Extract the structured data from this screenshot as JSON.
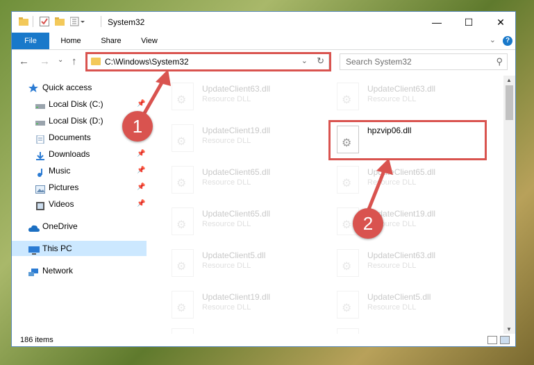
{
  "window": {
    "title": "System32",
    "min": "—",
    "max": "☐",
    "close": "✕"
  },
  "ribbon": {
    "tabs": [
      "File",
      "Home",
      "Share",
      "View"
    ],
    "expand": "⌄",
    "help": "?"
  },
  "nav": {
    "back": "←",
    "forward": "→",
    "recent": "⌄",
    "up": "↑"
  },
  "address": {
    "path": "C:\\Windows\\System32",
    "dropdown": "⌄",
    "refresh": "↻"
  },
  "search": {
    "placeholder": "Search System32",
    "icon": "⚲"
  },
  "sidebar": {
    "items": [
      {
        "label": "Quick access",
        "icon": "star-icon",
        "pinned": false
      },
      {
        "label": "Local Disk (C:)",
        "icon": "drive-icon",
        "pinned": true
      },
      {
        "label": "Local Disk (D:)",
        "icon": "drive-icon",
        "pinned": true
      },
      {
        "label": "Documents",
        "icon": "documents-icon",
        "pinned": true
      },
      {
        "label": "Downloads",
        "icon": "downloads-icon",
        "pinned": true
      },
      {
        "label": "Music",
        "icon": "music-icon",
        "pinned": true
      },
      {
        "label": "Pictures",
        "icon": "pictures-icon",
        "pinned": true
      },
      {
        "label": "Videos",
        "icon": "videos-icon",
        "pinned": true
      },
      {
        "label": "OneDrive",
        "icon": "onedrive-icon",
        "pinned": false
      },
      {
        "label": "This PC",
        "icon": "this-pc-icon",
        "pinned": false,
        "selected": true
      },
      {
        "label": "Network",
        "icon": "network-icon",
        "pinned": false
      }
    ],
    "pin_glyph": "📌"
  },
  "files": [
    {
      "name": "UpdateClient63.dll",
      "type": "Resource DLL"
    },
    {
      "name": "UpdateClient63.dll",
      "type": "Resource DLL"
    },
    {
      "name": "UpdateClient19.dll",
      "type": "Resource DLL"
    },
    {
      "name": "hpzvip06.dll",
      "type": "",
      "highlighted": true
    },
    {
      "name": "UpdateClient65.dll",
      "type": "Resource DLL"
    },
    {
      "name": "UpdateClient65.dll",
      "type": "Resource DLL"
    },
    {
      "name": "UpdateClient65.dll",
      "type": "Resource DLL"
    },
    {
      "name": "UpdateClient19.dll",
      "type": "Resource DLL"
    },
    {
      "name": "UpdateClient5.dll",
      "type": "Resource DLL"
    },
    {
      "name": "UpdateClient63.dll",
      "type": "Resource DLL"
    },
    {
      "name": "UpdateClient19.dll",
      "type": "Resource DLL"
    },
    {
      "name": "UpdateClient5.dll",
      "type": "Resource DLL"
    },
    {
      "name": "",
      "type": ""
    },
    {
      "name": "",
      "type": ""
    }
  ],
  "status": {
    "count": "186 items"
  },
  "callouts": {
    "one": "1",
    "two": "2"
  },
  "colors": {
    "accent": "#1979ca",
    "highlight": "#d9534f",
    "selected": "#cce8ff"
  }
}
